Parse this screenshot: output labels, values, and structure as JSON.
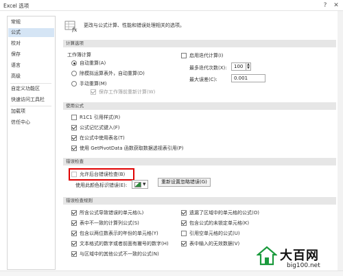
{
  "window": {
    "title": "Excel 选项",
    "help": "?",
    "close": "✕"
  },
  "sidebar": {
    "items": [
      {
        "label": "常规"
      },
      {
        "label": "公式"
      },
      {
        "label": "校对"
      },
      {
        "label": "保存"
      },
      {
        "label": "语言"
      },
      {
        "label": "高级"
      },
      {
        "label": "自定义功能区"
      },
      {
        "label": "快速访问工具栏"
      },
      {
        "label": "加载项"
      },
      {
        "label": "信任中心"
      }
    ],
    "selected": "公式"
  },
  "header": {
    "icon": "formula-fx-icon",
    "text": "更改与公式计算、性能和错误处理相关的选项。"
  },
  "calc": {
    "section": "计算选项",
    "workbook_calc_label": "工作簿计算",
    "radio_auto": "自动重算(A)",
    "radio_auto_except": "除模拟运算表外，自动重算(D)",
    "radio_manual": "手动重算(M)",
    "recalc_before_save": "保存工作簿前重新计算(W)",
    "iterative_label": "启用迭代计算(I)",
    "max_iter_label": "最多迭代次数(X):",
    "max_iter_value": "100",
    "max_change_label": "最大误差(C):",
    "max_change_value": "0.001"
  },
  "formulas": {
    "section": "使用公式",
    "r1c1": "R1C1 引用样式(R)",
    "autocomplete": "公式记忆式键入(F)",
    "table_names": "在公式中使用表名(T)",
    "getpivotdata": "使用 GetPivotData 函数获取数据透视表引用(P)"
  },
  "errors": {
    "section": "错误检查",
    "enable_bg": "允许后台错误检查(B)",
    "indicator_label": "使用此颜色标识错误(E):",
    "reset_button": "重新设置忽略错误(G)"
  },
  "rules": {
    "section": "错误检查规则",
    "left": [
      "所含公式导致错误的单元格(L)",
      "表中不一致的计算列公式(S)",
      "包含以两位数表示的年份的单元格(Y)",
      "文本格式的数字或者前面有撇号的数字(H)",
      "与区域中的其他公式不一致的公式(N)"
    ],
    "right": [
      "遗漏了区域中的单元格的公式(O)",
      "包含公式的未锁定单元格(K)",
      "引用空单元格的公式(U)",
      "表中输入的无效数据(V)"
    ]
  },
  "watermark": {
    "brand": "大百网",
    "url": "big100.net"
  },
  "colors": {
    "selected_item": "#d5e5f5",
    "section_bg": "#e6e6e6",
    "highlight": "#e00000",
    "swatch": "#2e8b3d"
  }
}
